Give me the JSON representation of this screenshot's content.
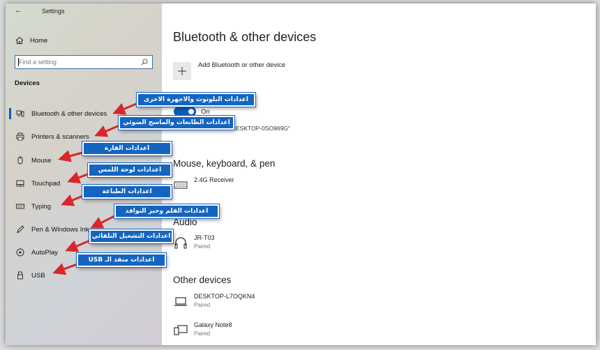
{
  "window": {
    "title": "Settings",
    "back_glyph": "←"
  },
  "sidebar": {
    "home_label": "Home",
    "search_placeholder": "Find a setting",
    "section_title": "Devices",
    "items": [
      {
        "label": "Bluetooth & other devices",
        "icon": "bluetooth-devices-icon",
        "selected": true
      },
      {
        "label": "Printers & scanners",
        "icon": "printer-icon"
      },
      {
        "label": "Mouse",
        "icon": "mouse-icon"
      },
      {
        "label": "Touchpad",
        "icon": "touchpad-icon"
      },
      {
        "label": "Typing",
        "icon": "keyboard-icon"
      },
      {
        "label": "Pen & Windows Ink",
        "icon": "pen-icon"
      },
      {
        "label": "AutoPlay",
        "icon": "autoplay-icon"
      },
      {
        "label": "USB",
        "icon": "usb-icon"
      }
    ]
  },
  "main": {
    "title": "Bluetooth & other devices",
    "add_device_label": "Add Bluetooth or other device",
    "bluetooth_toggle_state": "On",
    "discoverable_text": "Now discoverable as \"DESKTOP-0SO969G\"",
    "sections": {
      "mouse_keyboard_pen": {
        "title": "Mouse, keyboard, & pen",
        "devices": [
          {
            "name": "2.4G Receiver",
            "status": "",
            "icon": "keyboard-icon"
          }
        ]
      },
      "audio": {
        "title": "Audio",
        "devices": [
          {
            "name": "JR-T03",
            "status": "Paired",
            "icon": "headphones-icon"
          }
        ]
      },
      "other_devices": {
        "title": "Other devices",
        "devices": [
          {
            "name": "DESKTOP-L7OQKN4",
            "status": "Paired",
            "icon": "laptop-icon"
          },
          {
            "name": "Galaxy Note8",
            "status": "Paired",
            "icon": "phone-monitor-icon"
          }
        ]
      }
    }
  },
  "annotations": [
    {
      "text": "اعدادات البلوتوث والاجهزة الاخرى"
    },
    {
      "text": "اعدادات الطابعات والماسح الضوئي"
    },
    {
      "text": "اعدادات الفارة"
    },
    {
      "text": "اعدادات لوحة اللمس"
    },
    {
      "text": "اعدادات الطباعة"
    },
    {
      "text": "اعدادات القلم وحبر النوافذ"
    },
    {
      "text": "اعدادات التشغيل التلقائي"
    },
    {
      "text": "اعدادات منفذ الـ USB"
    }
  ],
  "colors": {
    "accent": "#0a5bbd",
    "callout": "#1565c0",
    "arrow": "#d9262b"
  }
}
